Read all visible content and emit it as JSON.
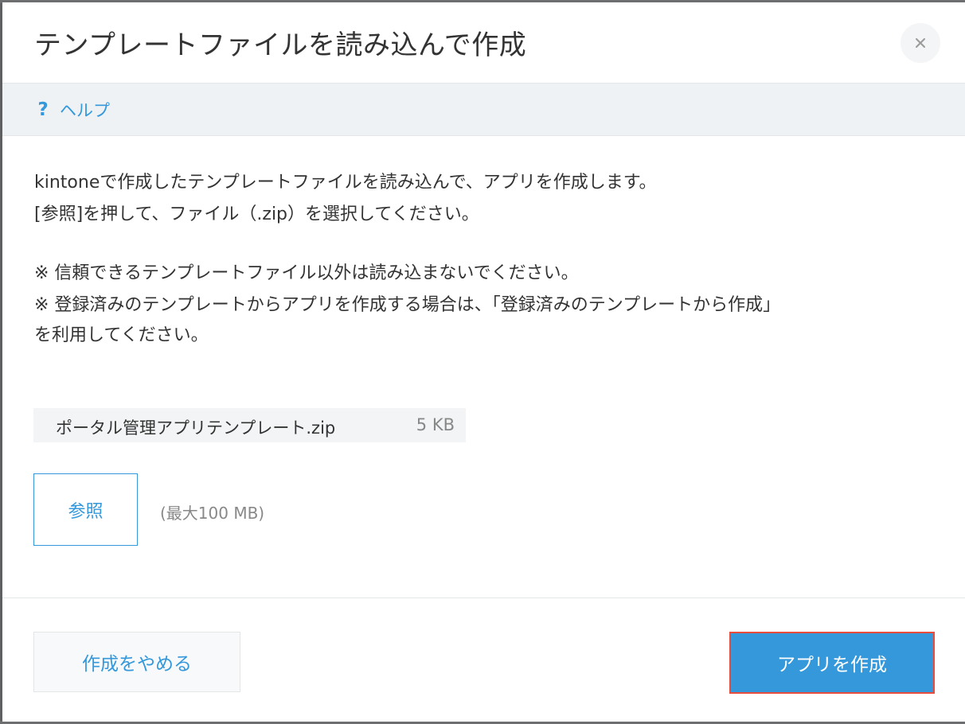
{
  "dialog": {
    "title": "テンプレートファイルを読み込んで作成",
    "close_label": "×"
  },
  "help": {
    "icon_label": "?",
    "label": "ヘルプ"
  },
  "body": {
    "description_lines": [
      "kintoneで作成したテンプレートファイルを読み込んで、アプリを作成します。",
      "[参照]を押して、ファイル（.zip）を選択してください。"
    ],
    "notes": [
      "※ 信頼できるテンプレートファイル以外は読み込まないでください。",
      "※ 登録済みのテンプレートからアプリを作成する場合は、「登録済みのテンプレートから作成」",
      "を利用してください。"
    ]
  },
  "file": {
    "name": "ポータル管理アプリテンプレート.zip",
    "size": "5 KB"
  },
  "browse": {
    "label": "参照",
    "max_size": "(最大100 MB)"
  },
  "footer": {
    "cancel_label": "作成をやめる",
    "create_label": "アプリを作成"
  },
  "colors": {
    "accent": "#3498db",
    "highlight": "#e74c3c",
    "help_bar": "#eef2f4",
    "text": "#333333",
    "muted": "#888888"
  }
}
